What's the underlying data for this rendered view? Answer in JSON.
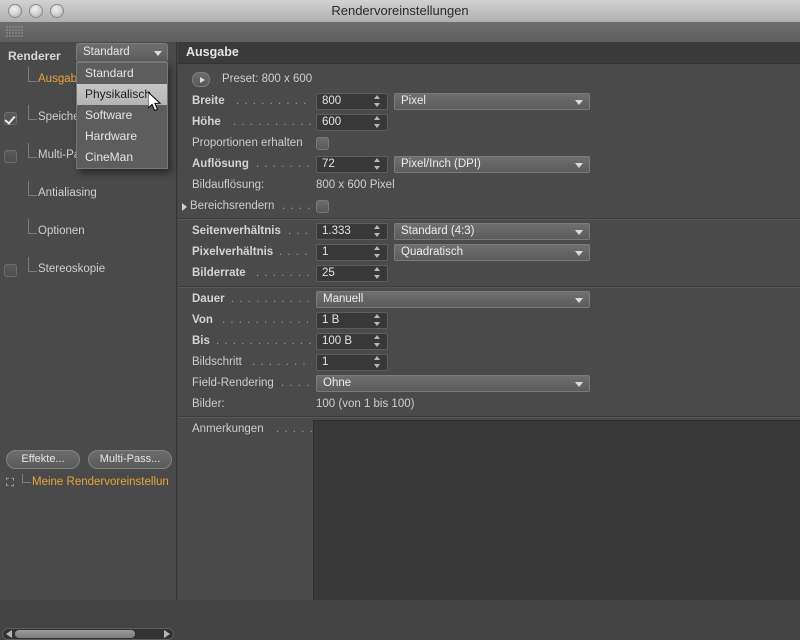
{
  "window": {
    "title": "Rendervoreinstellungen",
    "traffic_lights": [
      "close-button",
      "minimize-button",
      "zoom-button"
    ]
  },
  "left_panel": {
    "renderer_label": "Renderer",
    "renderer_value": "Standard",
    "tree_items": [
      {
        "label": "Ausgabe",
        "selected": true,
        "checkbox": "none"
      },
      {
        "label": "Speichern",
        "selected": false,
        "checkbox": "checked"
      },
      {
        "label": "Multi-Pass",
        "selected": false,
        "checkbox": "unchecked"
      },
      {
        "label": "Antialiasing",
        "selected": false,
        "checkbox": "none"
      },
      {
        "label": "Optionen",
        "selected": false,
        "checkbox": "none"
      },
      {
        "label": "Stereoskopie",
        "selected": false,
        "checkbox": "unchecked"
      }
    ],
    "buttons": {
      "effekte": "Effekte...",
      "multipass": "Multi-Pass..."
    },
    "preset_item": "Meine Rendervoreinstellun"
  },
  "renderer_menu": {
    "open": true,
    "highlighted": "Physikalisch",
    "items": [
      "Standard",
      "Physikalisch",
      "Software",
      "Hardware",
      "CineMan"
    ]
  },
  "output": {
    "section_title": "Ausgabe",
    "preset_label": "Preset: 800 x 600",
    "rows": {
      "breite": {
        "label": "Breite",
        "value": "800",
        "unit": "Pixel"
      },
      "hoehe": {
        "label": "Höhe",
        "value": "600"
      },
      "proportionen": {
        "label": "Proportionen erhalten",
        "checked": false
      },
      "aufloesung": {
        "label": "Auflösung",
        "value": "72",
        "unit": "Pixel/Inch (DPI)"
      },
      "bildaufloesung": {
        "label": "Bildauflösung:",
        "value": "800 x 600 Pixel"
      },
      "bereichsrendern": {
        "label": "Bereichsrendern",
        "checked": false
      }
    },
    "ratio_rows": {
      "seitenverhaeltnis": {
        "label": "Seitenverhältnis",
        "value": "1.333",
        "preset": "Standard (4:3)"
      },
      "pixelverhaeltnis": {
        "label": "Pixelverhältnis",
        "value": "1",
        "preset": "Quadratisch"
      },
      "bilderrate": {
        "label": "Bilderrate",
        "value": "25"
      }
    },
    "time_rows": {
      "dauer": {
        "label": "Dauer",
        "value": "Manuell"
      },
      "von": {
        "label": "Von",
        "value": "1 B"
      },
      "bis": {
        "label": "Bis",
        "value": "100 B"
      },
      "bildschritt": {
        "label": "Bildschritt",
        "value": "1"
      },
      "field_rendering": {
        "label": "Field-Rendering",
        "value": "Ohne"
      },
      "bilder": {
        "label": "Bilder:",
        "value": "100 (von 1 bis 100)"
      }
    },
    "notes": {
      "label": "Anmerkungen",
      "value": ""
    }
  },
  "colors": {
    "panel_bg": "#4a4a4a",
    "section_header_bg": "#3a3a3a",
    "field_bg": "#383838",
    "accent_orange": "#e8a33d",
    "text": "#d4d4d4"
  }
}
